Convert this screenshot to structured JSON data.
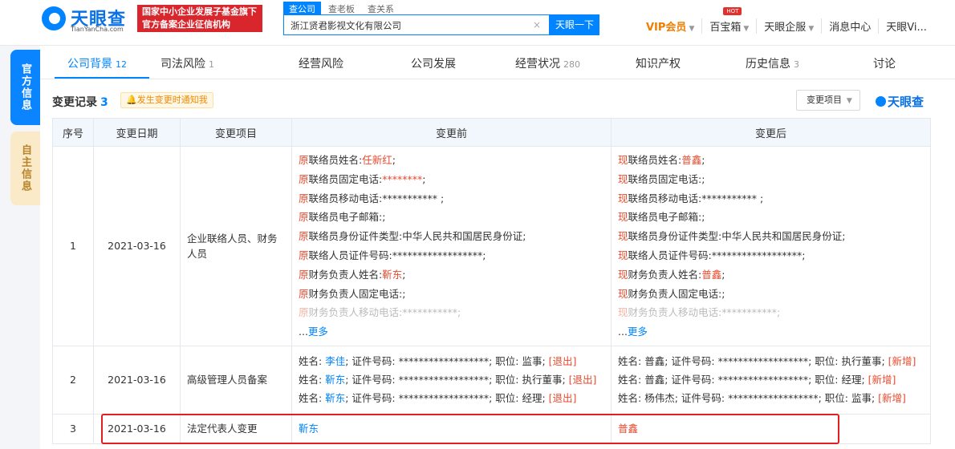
{
  "header": {
    "logo_cn": "天眼查",
    "logo_en": "TianYanCha.com",
    "gov_badge_line1": "国家中小企业发展子基金旗下",
    "gov_badge_line2": "官方备案企业征信机构",
    "search_tabs": [
      "查公司",
      "查老板",
      "查关系"
    ],
    "search_value": "浙江贤君影视文化有限公司",
    "search_button": "天眼一下",
    "nav": {
      "vip": "VIP会员",
      "treasure": "百宝箱",
      "hot": "HOT",
      "enterprise": "天眼企服",
      "messages": "消息中心",
      "user": "天眼Vi..."
    }
  },
  "side_tabs": {
    "official": "官方信息",
    "self": "自主信息"
  },
  "tabs": [
    {
      "label": "公司背景",
      "count": "12"
    },
    {
      "label": "司法风险",
      "count": "1"
    },
    {
      "label": "经营风险",
      "count": ""
    },
    {
      "label": "公司发展",
      "count": ""
    },
    {
      "label": "经营状况",
      "count": "280"
    },
    {
      "label": "知识产权",
      "count": ""
    },
    {
      "label": "历史信息",
      "count": "3"
    },
    {
      "label": "讨论",
      "count": ""
    }
  ],
  "section": {
    "title": "变更记录",
    "count": "3",
    "notify": "发生变更时通知我",
    "filter": "变更项目",
    "brand": "天眼查"
  },
  "table": {
    "headers": [
      "序号",
      "变更日期",
      "变更项目",
      "变更前",
      "变更后"
    ],
    "row1": {
      "index": "1",
      "date": "2021-03-16",
      "item": "企业联络人员、财务人员",
      "before": [
        {
          "prefix": "原",
          "label": "联络员姓名:",
          "value": "任新红",
          "suffix": ";"
        },
        {
          "prefix": "原",
          "label": "联络员固定电话:",
          "value": "********",
          "suffix": ";"
        },
        {
          "prefix": "原",
          "label": "联络员移动电话:*********** ;",
          "value": "",
          "suffix": ""
        },
        {
          "prefix": "原",
          "label": "联络员电子邮箱:;",
          "value": "",
          "suffix": ""
        },
        {
          "prefix": "原",
          "label": "联络员身份证件类型:中华人民共和国居民身份证;",
          "value": "",
          "suffix": ""
        },
        {
          "prefix": "原",
          "label": "联络人员证件号码:******************;",
          "value": "",
          "suffix": ""
        },
        {
          "prefix": "原",
          "label": "财务负责人姓名:",
          "value": "靳东",
          "suffix": ";"
        },
        {
          "prefix": "原",
          "label": "财务负责人固定电话:;",
          "value": "",
          "suffix": ""
        },
        {
          "prefix": "原",
          "label": "财务负责人移动电话:***********;",
          "value": "",
          "suffix": ""
        }
      ],
      "after": [
        {
          "prefix": "现",
          "label": "联络员姓名:",
          "value": "普鑫",
          "suffix": ";"
        },
        {
          "prefix": "现",
          "label": "联络员固定电话:;",
          "value": "",
          "suffix": ""
        },
        {
          "prefix": "现",
          "label": "联络员移动电话:*********** ;",
          "value": "",
          "suffix": ""
        },
        {
          "prefix": "现",
          "label": "联络员电子邮箱:;",
          "value": "",
          "suffix": ""
        },
        {
          "prefix": "现",
          "label": "联络员身份证件类型:中华人民共和国居民身份证;",
          "value": "",
          "suffix": ""
        },
        {
          "prefix": "现",
          "label": "联络人员证件号码:******************;",
          "value": "",
          "suffix": ""
        },
        {
          "prefix": "现",
          "label": "财务负责人姓名:",
          "value": "普鑫",
          "suffix": ";"
        },
        {
          "prefix": "现",
          "label": "财务负责人固定电话:;",
          "value": "",
          "suffix": ""
        },
        {
          "prefix": "现",
          "label": "财务负责人移动电话:***********;",
          "value": "",
          "suffix": ""
        }
      ],
      "more_prefix": "...",
      "more": "更多"
    },
    "row2": {
      "index": "2",
      "date": "2021-03-16",
      "item": "高级管理人员备案",
      "before": [
        {
          "name": "李佳",
          "id": "******************",
          "role": "监事",
          "tag": "[退出]"
        },
        {
          "name": "靳东",
          "id": "******************",
          "role": "执行董事",
          "tag": "[退出]"
        },
        {
          "name": "靳东",
          "id": "******************",
          "role": "经理",
          "tag": "[退出]"
        }
      ],
      "after": [
        {
          "name": "普鑫",
          "id": "******************",
          "role": "执行董事",
          "tag": "[新增]"
        },
        {
          "name": "普鑫",
          "id": "******************",
          "role": "经理",
          "tag": "[新增]"
        },
        {
          "name": "杨伟杰",
          "id": "******************",
          "role": "监事",
          "tag": "[新增]"
        }
      ],
      "labels": {
        "name": "姓名: ",
        "id": "; 证件号码: ",
        "role": "; 职位: ",
        "sep": "; "
      }
    },
    "row3": {
      "index": "3",
      "date": "2021-03-16",
      "item": "法定代表人变更",
      "before": "靳东",
      "after": "普鑫"
    }
  },
  "colors": {
    "accent": "#0084ff",
    "prefix_red": "#e84a2e",
    "highlight_box": "#e02020"
  }
}
